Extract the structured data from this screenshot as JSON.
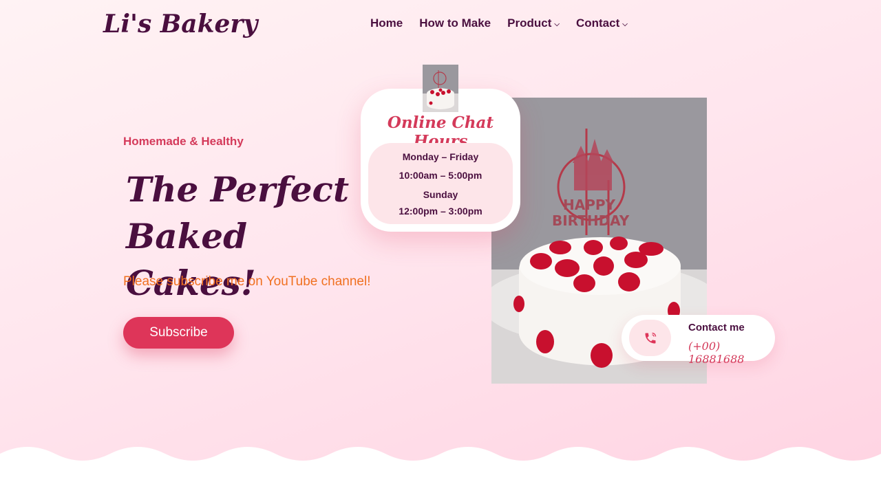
{
  "header": {
    "logo": "Li's Bakery",
    "nav": [
      {
        "label": "Home"
      },
      {
        "label": "How to Make"
      },
      {
        "label": "Product",
        "chevron": "⌵"
      },
      {
        "label": "Contact",
        "chevron": "⌵"
      }
    ]
  },
  "hero": {
    "tagline": "Homemade & Healthy",
    "title": "The Perfect Baked Cakes!",
    "subline": "Please subscribe me on YouTube channel!",
    "button": "Subscribe"
  },
  "chat_card": {
    "title": "Online Chat Hours",
    "hours": [
      "Monday – Friday",
      "10:00am – 5:00pm",
      "Sunday",
      "12:00pm – 3:00pm"
    ]
  },
  "contact_card": {
    "label": "Contact me",
    "phone": "(+00) 16881688",
    "icon": "phone-icon"
  },
  "colors": {
    "brand_dark": "#4a0f3f",
    "accent_red": "#de3559",
    "accent_orange": "#f07020",
    "card_pink": "#fde5e9"
  }
}
